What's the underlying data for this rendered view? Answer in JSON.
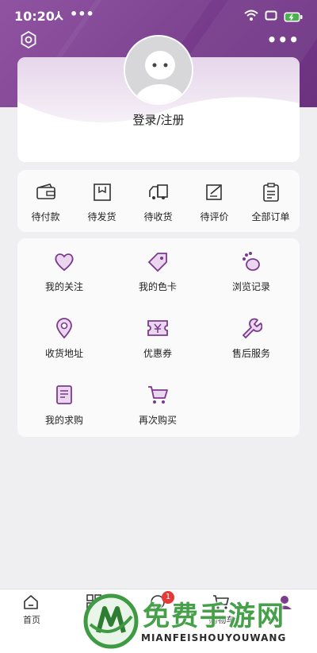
{
  "status_bar": {
    "time": "10:20",
    "battery_color": "#4caf50"
  },
  "theme": {
    "accent": "#7a3d8f",
    "icon_color": "#7b3b8c"
  },
  "profile": {
    "login_label": "登录/注册"
  },
  "orders": [
    {
      "label": "待付款",
      "icon": "wallet-icon"
    },
    {
      "label": "待发货",
      "icon": "package-icon"
    },
    {
      "label": "待收货",
      "icon": "truck-icon"
    },
    {
      "label": "待评价",
      "icon": "review-icon"
    },
    {
      "label": "全部订单",
      "icon": "clipboard-icon"
    }
  ],
  "services": [
    {
      "label": "我的关注",
      "icon": "heart-icon"
    },
    {
      "label": "我的色卡",
      "icon": "tag-icon"
    },
    {
      "label": "浏览记录",
      "icon": "footprint-icon"
    },
    {
      "label": "收货地址",
      "icon": "location-icon"
    },
    {
      "label": "优惠券",
      "icon": "coupon-icon"
    },
    {
      "label": "售后服务",
      "icon": "wrench-icon"
    },
    {
      "label": "我的求购",
      "icon": "document-icon"
    },
    {
      "label": "再次购买",
      "icon": "cart-icon"
    }
  ],
  "tabbar": [
    {
      "label": "首页",
      "icon": "home-icon"
    },
    {
      "label": "",
      "icon": "category-icon"
    },
    {
      "label": "",
      "icon": "message-icon",
      "badge": "1"
    },
    {
      "label": "购物车",
      "icon": "cart-icon"
    },
    {
      "label": "",
      "icon": "profile-icon"
    }
  ],
  "watermark": {
    "title": "免费手游网",
    "subtitle": "MIANFEISHOUYOUWANG"
  }
}
